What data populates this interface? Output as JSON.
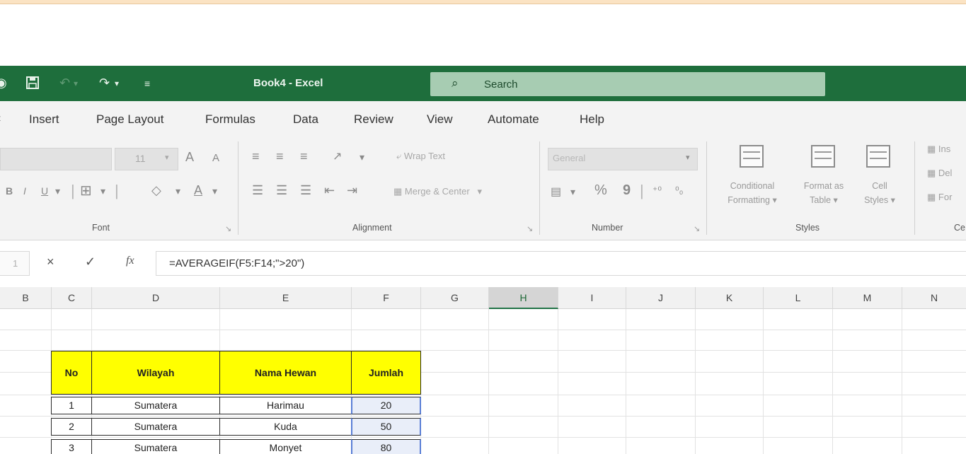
{
  "window": {
    "title": "Book4 - Excel",
    "search_placeholder": "Search",
    "search_icon": "search-icon",
    "quick_access": [
      "autosave-toggle-icon",
      "save-icon",
      "undo-icon",
      "redo-icon",
      "customize-quick-access-icon"
    ]
  },
  "menu": {
    "tabs": [
      "Insert",
      "Page Layout",
      "Formulas",
      "Data",
      "Review",
      "View",
      "Automate",
      "Help"
    ]
  },
  "ribbon": {
    "font": {
      "group_label": "Font",
      "size_value": "11",
      "grow_label": "A",
      "shrink_label": "A",
      "bold_label": "B",
      "italic_label": "I",
      "underline_label": "U",
      "font_color_label": "A"
    },
    "alignment": {
      "group_label": "Alignment",
      "wrap_text_label": "Wrap Text",
      "merge_center_label": "Merge & Center"
    },
    "number": {
      "group_label": "Number",
      "format_value": "General",
      "percent_label": "%",
      "comma_label": "9"
    },
    "styles": {
      "group_label": "Styles",
      "conditional_formatting_line1": "Conditional",
      "conditional_formatting_line2": "Formatting",
      "format_as_table_line1": "Format as",
      "format_as_table_line2": "Table",
      "cell_styles_line1": "Cell",
      "cell_styles_line2": "Styles"
    },
    "cells": {
      "group_label": "Ce",
      "insert_label": "Ins",
      "delete_label": "Del",
      "format_label": "For"
    }
  },
  "formula_bar": {
    "name_box": "1",
    "cancel_icon": "×",
    "enter_icon": "✓",
    "fx_label": "fx",
    "formula": "=AVERAGEIF(F5:F14;\">20\")"
  },
  "columns": [
    "B",
    "C",
    "D",
    "E",
    "F",
    "G",
    "H",
    "I",
    "J",
    "K",
    "L",
    "M",
    "N"
  ],
  "active_column": "H",
  "table": {
    "headers": [
      "No",
      "Wilayah",
      "Nama Hewan",
      "Jumlah"
    ],
    "rows": [
      {
        "no": "1",
        "wilayah": "Sumatera",
        "hewan": "Harimau",
        "jumlah": "20"
      },
      {
        "no": "2",
        "wilayah": "Sumatera",
        "hewan": "Kuda",
        "jumlah": "50"
      },
      {
        "no": "3",
        "wilayah": "Sumatera",
        "hewan": "Monyet",
        "jumlah": "80"
      }
    ]
  },
  "colors": {
    "titlebar": "#1e6e3c",
    "header_fill": "#ffff00",
    "selection_border": "#5b7fd6"
  }
}
